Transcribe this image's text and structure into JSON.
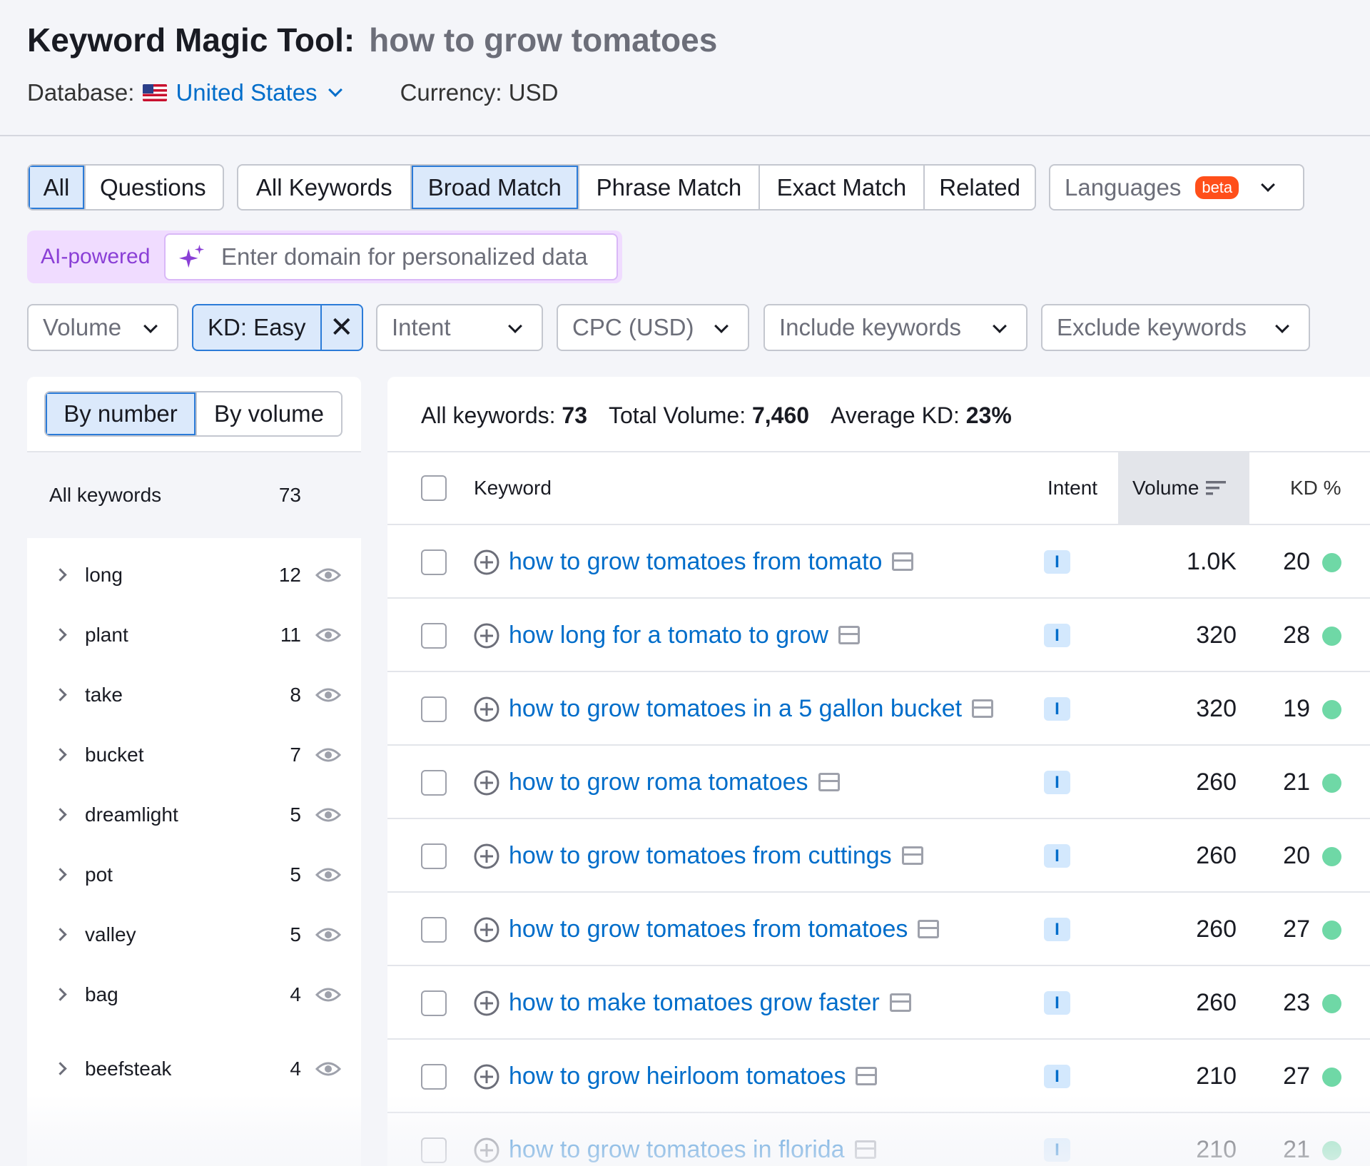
{
  "header": {
    "title": "Keyword Magic Tool:",
    "query": "how to grow tomatoes",
    "database_label": "Database:",
    "database_value": "United States",
    "currency": "Currency: USD"
  },
  "tabs": {
    "type_group": [
      {
        "label": "All",
        "active": true
      },
      {
        "label": "Questions",
        "active": false
      }
    ],
    "match_group": [
      {
        "label": "All Keywords",
        "active": false
      },
      {
        "label": "Broad Match",
        "active": true
      },
      {
        "label": "Phrase Match",
        "active": false
      },
      {
        "label": "Exact Match",
        "active": false
      },
      {
        "label": "Related",
        "active": false
      }
    ],
    "languages": {
      "label": "Languages",
      "badge": "beta"
    }
  },
  "ai": {
    "label": "AI-powered",
    "placeholder": "Enter domain for personalized data"
  },
  "filters": {
    "volume": "Volume",
    "kd": "KD: Easy",
    "kd_clear": "✕",
    "intent": "Intent",
    "cpc": "CPC (USD)",
    "include": "Include keywords",
    "exclude": "Exclude keywords"
  },
  "left_panel": {
    "toggle": [
      {
        "label": "By number",
        "active": true
      },
      {
        "label": "By volume",
        "active": false
      }
    ],
    "all_keywords": {
      "label": "All keywords",
      "count": "73"
    },
    "groups": [
      {
        "name": "long",
        "count": "12"
      },
      {
        "name": "plant",
        "count": "11"
      },
      {
        "name": "take",
        "count": "8"
      },
      {
        "name": "bucket",
        "count": "7"
      },
      {
        "name": "dreamlight",
        "count": "5"
      },
      {
        "name": "pot",
        "count": "5"
      },
      {
        "name": "valley",
        "count": "5"
      },
      {
        "name": "bag",
        "count": "4"
      },
      {
        "name": "beefsteak",
        "count": "4"
      }
    ]
  },
  "summary": {
    "all_label": "All keywords:",
    "all_value": "73",
    "volume_label": "Total Volume:",
    "volume_value": "7,460",
    "kd_label": "Average KD:",
    "kd_value": "23%"
  },
  "table": {
    "headers": {
      "keyword": "Keyword",
      "intent": "Intent",
      "volume": "Volume",
      "kd": "KD %"
    },
    "rows": [
      {
        "keyword": "how to grow tomatoes from tomato",
        "intent": "I",
        "volume": "1.0K",
        "kd": "20"
      },
      {
        "keyword": "how long for a tomato to grow",
        "intent": "I",
        "volume": "320",
        "kd": "28"
      },
      {
        "keyword": "how to grow tomatoes in a 5 gallon bucket",
        "intent": "I",
        "volume": "320",
        "kd": "19"
      },
      {
        "keyword": "how to grow roma tomatoes",
        "intent": "I",
        "volume": "260",
        "kd": "21"
      },
      {
        "keyword": "how to grow tomatoes from cuttings",
        "intent": "I",
        "volume": "260",
        "kd": "20"
      },
      {
        "keyword": "how to grow tomatoes from tomatoes",
        "intent": "I",
        "volume": "260",
        "kd": "27"
      },
      {
        "keyword": "how to make tomatoes grow faster",
        "intent": "I",
        "volume": "260",
        "kd": "23"
      },
      {
        "keyword": "how to grow heirloom tomatoes",
        "intent": "I",
        "volume": "210",
        "kd": "27"
      },
      {
        "keyword": "how to grow tomatoes in florida",
        "intent": "I",
        "volume": "210",
        "kd": "21"
      }
    ]
  },
  "colors": {
    "kd_easy": "#6fd8a6",
    "link": "#006dca",
    "active_tab": "#dbe9fb",
    "ai_accent": "#8a3fd6"
  }
}
